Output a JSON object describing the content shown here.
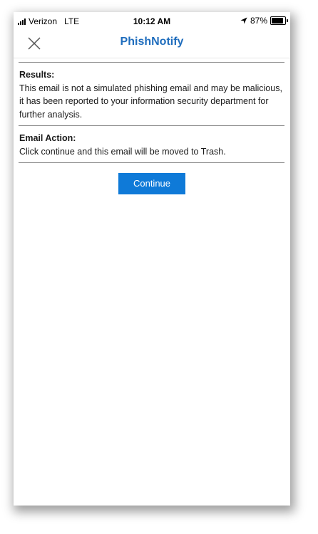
{
  "status_bar": {
    "carrier": "Verizon",
    "network": "LTE",
    "time": "10:12 AM",
    "battery_percent": "87%",
    "battery_level": 0.87
  },
  "nav": {
    "title": "PhishNotify",
    "title_color": "#1f6dbd",
    "close_icon": "close-x"
  },
  "results": {
    "title": "Results:",
    "text": "This email is not a simulated phishing email and may be malicious, it has been reported to your information security department for further analysis."
  },
  "email_action": {
    "title": "Email Action:",
    "text": "Click continue and this email will be moved to Trash."
  },
  "continue_button": {
    "label": "Continue",
    "color": "#0f7ad8"
  }
}
